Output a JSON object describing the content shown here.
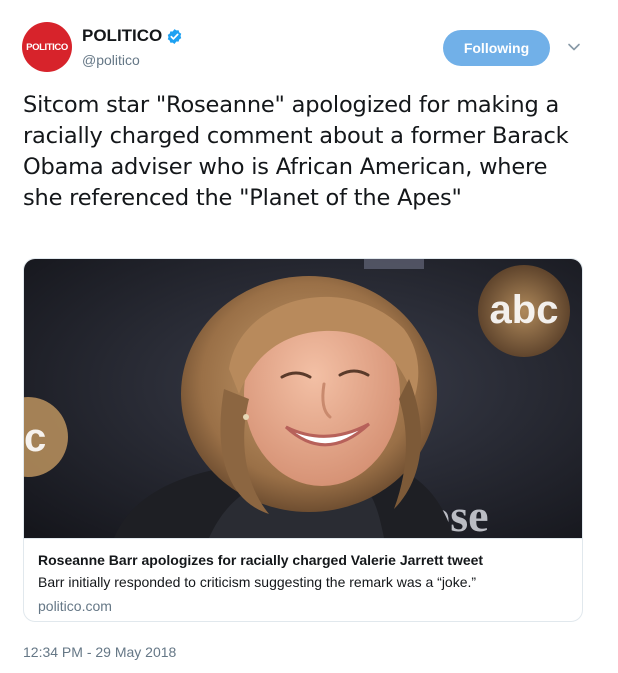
{
  "author": {
    "avatar_text": "POLITICO",
    "display_name": "POLITICO",
    "handle": "@politico",
    "verified": true
  },
  "follow_button": {
    "label": "Following"
  },
  "tweet": {
    "text": "Sitcom star \"Roseanne\" apologized for making a racially charged comment about a former Barack Obama adviser who is African American, where she referenced the \"Planet of the Apes\"",
    "timestamp": "12:34 PM - 29 May 2018"
  },
  "card": {
    "image_logo_text": "abc",
    "image_sign_text": "Rose",
    "image_sign_left": "c",
    "title": "Roseanne Barr apologizes for racially charged Valerie Jarrett tweet",
    "description": "Barr initially responded to criticism suggesting the remark was a “joke.”",
    "domain": "politico.com"
  },
  "colors": {
    "brand_red": "#d7232b",
    "follow_blue": "#71b0e8",
    "verified_blue": "#1da1f2",
    "secondary_text": "#657786"
  },
  "icons": {
    "verified": "verified-badge-icon",
    "caret": "chevron-down-icon"
  }
}
